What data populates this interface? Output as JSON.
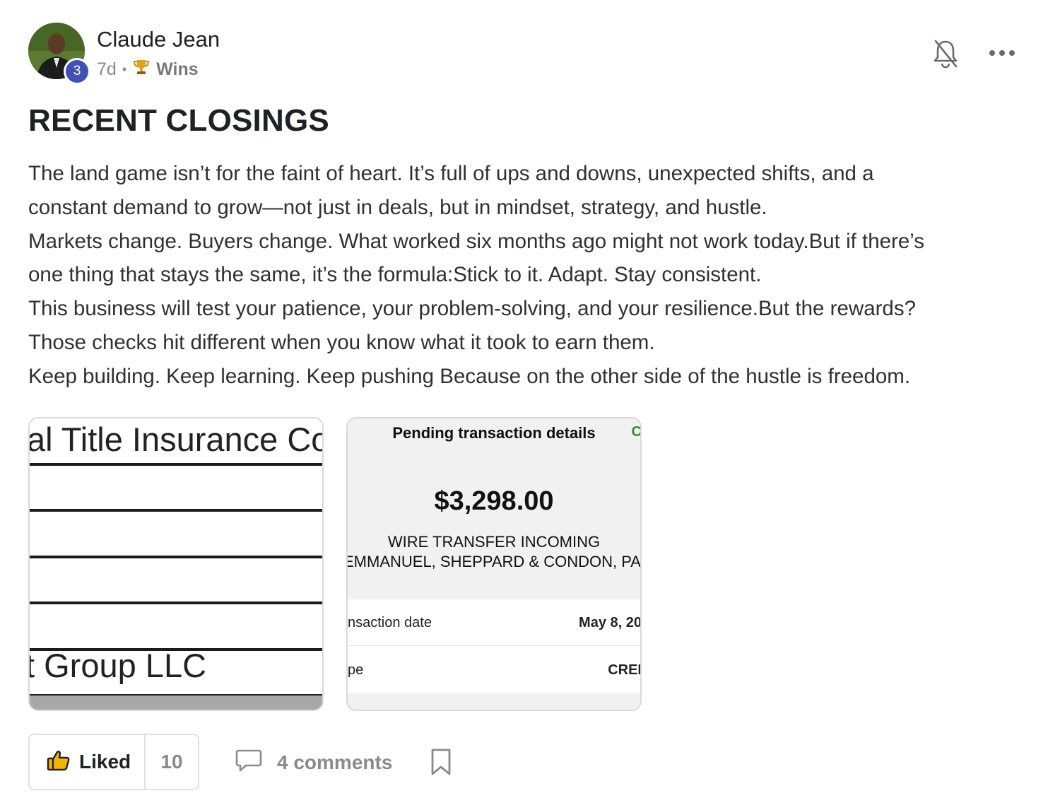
{
  "post": {
    "author": "Claude Jean",
    "level": "3",
    "age": "7d",
    "separator": "•",
    "category_icon": "trophy-icon",
    "category": "Wins",
    "title": "RECENT CLOSINGS",
    "paragraphs": [
      "The land game isn’t for the faint of heart. It’s full of ups and downs, unexpected shifts, and a",
      "constant demand to grow—not just in deals, but in mindset, strategy, and hustle.",
      "Markets change. Buyers change. What worked six months ago might not work today.But if there’s",
      "one thing that stays the same, it’s the formula:Stick to it. Adapt. Stay consistent.",
      "This business will test your patience, your problem-solving, and your resilience.But the rewards?",
      "Those checks hit different when you know what it took to earn them.",
      "Keep building. Keep learning. Keep pushing Because on the other side of the hustle is freedom."
    ]
  },
  "attachments": {
    "doc": {
      "top_text": "al Title Insurance Com",
      "bottom_text": "t Group LLC"
    },
    "transaction": {
      "header": "Pending transaction details",
      "header_edge": "C",
      "amount": "$3,298.00",
      "desc1": "WIRE TRANSFER INCOMING",
      "desc2": "EMMANUEL, SHEPPARD & CONDON, PA",
      "rows": [
        {
          "key": "nsaction date",
          "value": "May 8, 20"
        },
        {
          "key": "pe",
          "value": "CREI"
        }
      ]
    }
  },
  "actions": {
    "like_label": "Liked",
    "like_count": "10",
    "comments_label": "4 comments"
  },
  "colors": {
    "badge": "#3f51b5",
    "text": "#202124",
    "muted": "#8a8a8a"
  }
}
